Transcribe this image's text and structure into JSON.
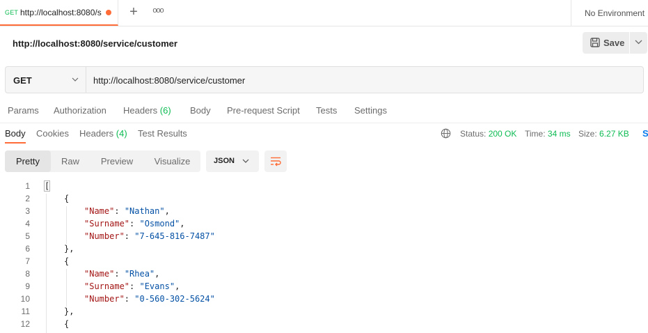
{
  "tab_bar": {
    "active_tab": {
      "method": "GET",
      "name": "http://localhost:8080/s"
    },
    "add_tab_label": "+",
    "more_label": "ooo",
    "environment": "No Environment"
  },
  "request": {
    "title": "http://localhost:8080/service/customer",
    "save_label": "Save",
    "method": "GET",
    "url": "http://localhost:8080/service/customer"
  },
  "request_tabs": {
    "params": "Params",
    "authorization": "Authorization",
    "headers": "Headers",
    "headers_count": "(6)",
    "body": "Body",
    "pre_request_script": "Pre-request Script",
    "tests": "Tests",
    "settings": "Settings"
  },
  "response_tabs": {
    "body": "Body",
    "cookies": "Cookies",
    "headers": "Headers",
    "headers_count": "(4)",
    "test_results": "Test Results"
  },
  "response_meta": {
    "status_label": "Status:",
    "status_value": "200 OK",
    "time_label": "Time:",
    "time_value": "34 ms",
    "size_label": "Size:",
    "size_value": "6.27 KB",
    "save_response_label": "S"
  },
  "view": {
    "modes": [
      "Pretty",
      "Raw",
      "Preview",
      "Visualize"
    ],
    "active_mode": "Pretty",
    "format": "JSON"
  },
  "code": {
    "line_numbers": [
      "1",
      "2",
      "3",
      "4",
      "5",
      "6",
      "7",
      "8",
      "9",
      "10",
      "11",
      "12"
    ],
    "open_array": "[",
    "open_obj": "{",
    "close_obj": "},",
    "records": [
      {
        "name_key": "\"Name\"",
        "name_val": "\"Nathan\"",
        "surname_key": "\"Surname\"",
        "surname_val": "\"Osmond\"",
        "number_key": "\"Number\"",
        "number_val": "\"7-645-816-7487\""
      },
      {
        "name_key": "\"Name\"",
        "name_val": "\"Rhea\"",
        "surname_key": "\"Surname\"",
        "surname_val": "\"Evans\"",
        "number_key": "\"Number\"",
        "number_val": "\"0-560-302-5624\""
      }
    ]
  },
  "colors": {
    "accent": "#ff6c37",
    "success": "#0cbb52",
    "json_key": "#a31515",
    "json_string": "#0451a5"
  }
}
